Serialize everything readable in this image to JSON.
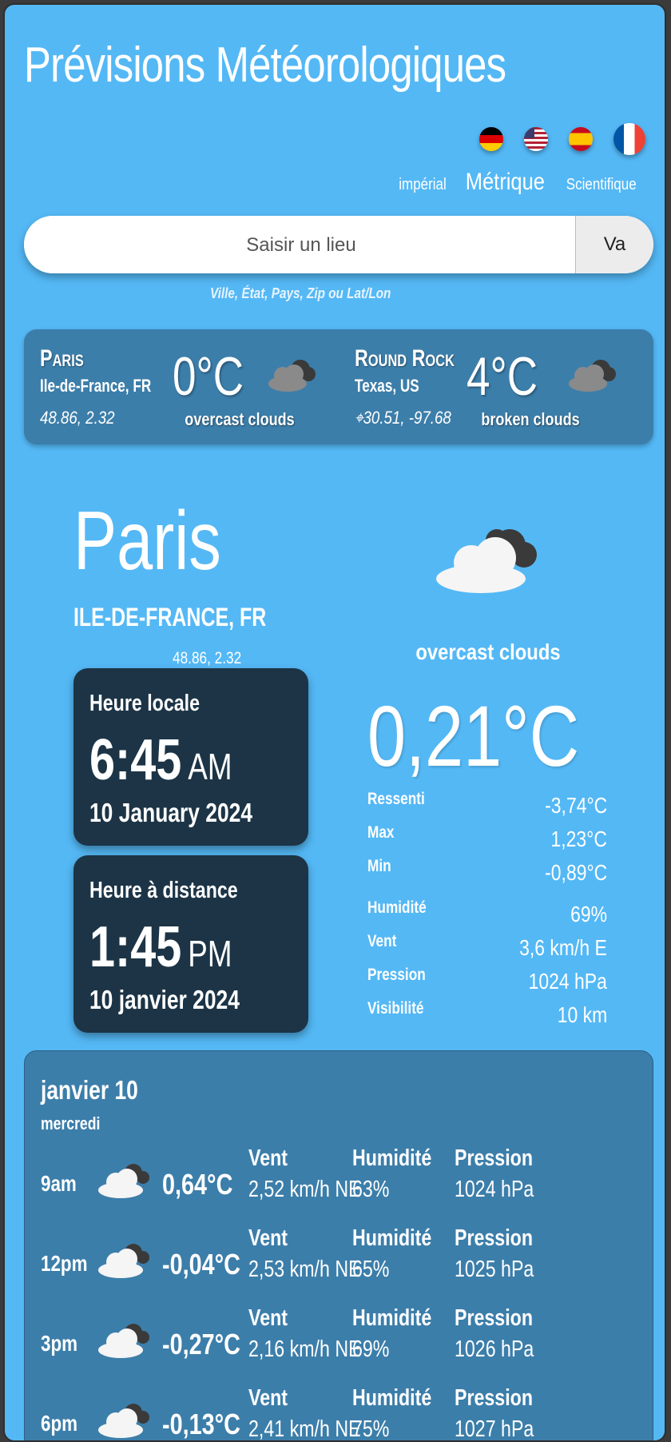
{
  "header": {
    "title": "Prévisions Météorologiques"
  },
  "languages": [
    {
      "code": "de",
      "icon": "germany-flag-icon"
    },
    {
      "code": "us",
      "icon": "usa-flag-icon"
    },
    {
      "code": "es",
      "icon": "spain-flag-icon"
    },
    {
      "code": "fr",
      "icon": "france-flag-icon",
      "selected": true
    }
  ],
  "units": {
    "imperial": "impérial",
    "metric": "Métrique",
    "scientific": "Scientifique",
    "selected": "metric"
  },
  "search": {
    "placeholder": "Saisir un lieu",
    "value": "",
    "button_label": "Va",
    "hint": "Ville, État, Pays, Zip ou Lat/Lon"
  },
  "recent": [
    {
      "city": "Paris",
      "region": "Ile-de-France, FR",
      "coords": "48.86, 2.32",
      "temp": "0°C",
      "condition": "overcast clouds",
      "icon": "overcast-clouds-icon"
    },
    {
      "city": "Round Rock",
      "region": "Texas, US",
      "coords": "30.51, -97.68",
      "coords_icon": "location-target-icon",
      "temp": "4°C",
      "condition": "broken clouds",
      "icon": "broken-clouds-icon"
    }
  ],
  "current": {
    "city": "Paris",
    "region": "Ile-de-France, FR",
    "coords": "48.86, 2.32",
    "condition": "overcast clouds",
    "icon": "overcast-clouds-icon",
    "temp": "0,21°C",
    "details": [
      {
        "label": "Ressenti",
        "value": "-3,74°C"
      },
      {
        "label": "Max",
        "value": "1,23°C"
      },
      {
        "label": "Min",
        "value": "-0,89°C"
      },
      {
        "label": "Humidité",
        "value": "69%"
      },
      {
        "label": "Vent",
        "value": "3,6 km/h E"
      },
      {
        "label": "Pression",
        "value": "1024 hPa"
      },
      {
        "label": "Visibilité",
        "value": "10 km"
      }
    ],
    "local_time": {
      "label": "Heure locale",
      "time": "6:45",
      "ampm": "AM",
      "date": "10 January 2024"
    },
    "remote_time": {
      "label": "Heure à distance",
      "time": "1:45",
      "ampm": "PM",
      "date": "10 janvier 2024"
    }
  },
  "forecast": {
    "date": "janvier 10",
    "weekday": "mercredi",
    "labels": {
      "wind": "Vent",
      "humidity": "Humidité",
      "pressure": "Pression"
    },
    "hours": [
      {
        "hour": "9am",
        "temp": "0,64°C",
        "wind": "2,52 km/h NE",
        "humidity": "63%",
        "pressure": "1024 hPa",
        "icon": "cloud-icon"
      },
      {
        "hour": "12pm",
        "temp": "-0,04°C",
        "wind": "2,53 km/h NE",
        "humidity": "65%",
        "pressure": "1025 hPa",
        "icon": "cloud-icon"
      },
      {
        "hour": "3pm",
        "temp": "-0,27°C",
        "wind": "2,16 km/h NE",
        "humidity": "69%",
        "pressure": "1026 hPa",
        "icon": "cloud-icon"
      },
      {
        "hour": "6pm",
        "temp": "-0,13°C",
        "wind": "2,41 km/h NE",
        "humidity": "75%",
        "pressure": "1027 hPa",
        "icon": "cloud-icon"
      }
    ]
  },
  "colors": {
    "background": "#54b8f5",
    "panel": "#3c7eaa",
    "timecard": "#1c3446"
  }
}
